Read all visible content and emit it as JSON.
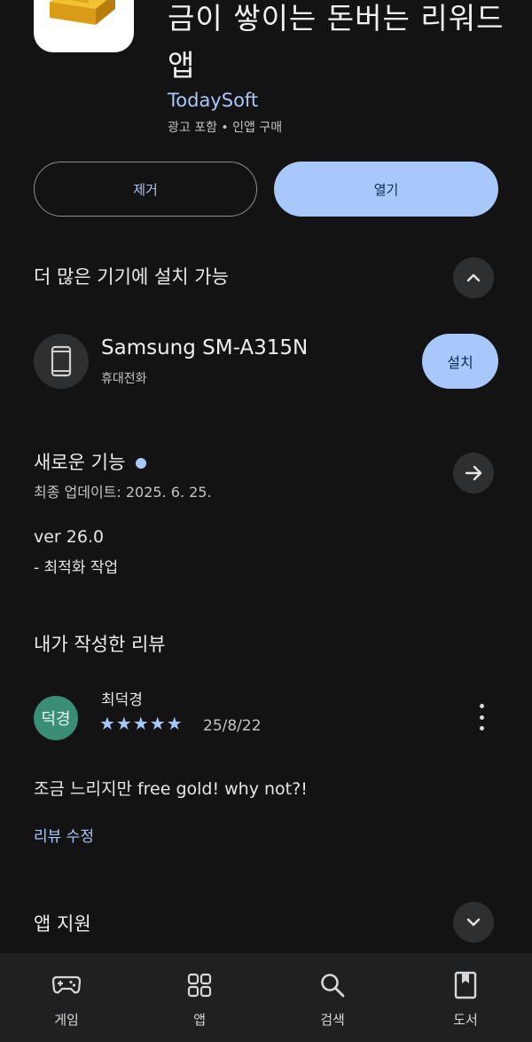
{
  "app": {
    "title": "금이 쌓이는 돈버는 리워드 앱",
    "developer": "TodaySoft",
    "ad_info": "광고 포함 • 인앱 구매",
    "icon": "gold-bars-icon"
  },
  "actions": {
    "remove_label": "제거",
    "open_label": "열기"
  },
  "devices_section": {
    "title": "더 많은 기기에 설치 가능",
    "device_name": "Samsung SM-A315N",
    "device_type": "휴대전화",
    "install_label": "설치"
  },
  "whats_new": {
    "title": "새로운 기능",
    "updated": "최종 업데이트: 2025. 6. 25.",
    "version": "ver 26.0",
    "changes": "- 최적화 작업"
  },
  "my_review": {
    "title": "내가 작성한 리뷰",
    "avatar_text": "덕경",
    "reviewer": "최덕경",
    "rating": 5,
    "stars": "★★★★★",
    "date": "25/8/22",
    "text": "조금 느리지만 free gold! why not?!",
    "edit_label": "리뷰 수정"
  },
  "app_support": {
    "title": "앱 지원"
  },
  "bottom_nav": [
    {
      "label": "게임",
      "icon": "gamepad-icon"
    },
    {
      "label": "앱",
      "icon": "apps-grid-icon"
    },
    {
      "label": "검색",
      "icon": "search-icon"
    },
    {
      "label": "도서",
      "icon": "book-icon"
    }
  ],
  "colors": {
    "background": "#131313",
    "accent": "#a8c7fa",
    "avatar": "#3a8e76"
  }
}
